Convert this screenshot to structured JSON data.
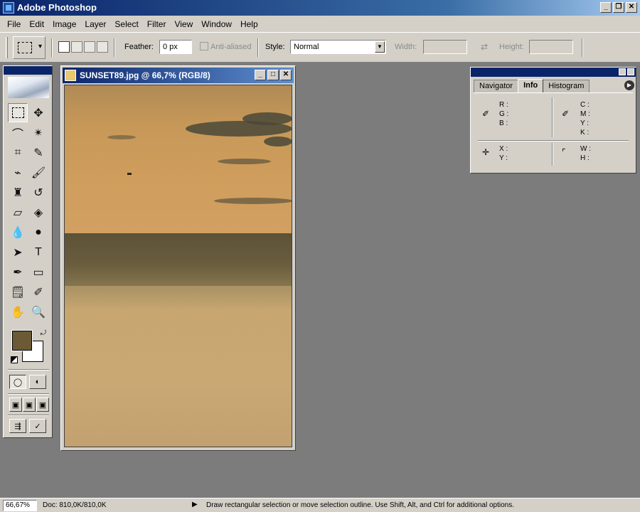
{
  "window": {
    "title": "Adobe Photoshop"
  },
  "menu": [
    "File",
    "Edit",
    "Image",
    "Layer",
    "Select",
    "Filter",
    "View",
    "Window",
    "Help"
  ],
  "options": {
    "feather_label": "Feather:",
    "feather_value": "0 px",
    "antialiased_label": "Anti-aliased",
    "style_label": "Style:",
    "style_value": "Normal",
    "width_label": "Width:",
    "height_label": "Height:"
  },
  "document": {
    "title": "SUNSET89.jpg @ 66,7% (RGB/8)"
  },
  "colors": {
    "foreground": "#6b5a35",
    "background": "#ffffff"
  },
  "info_panel": {
    "tabs": [
      "Navigator",
      "Info",
      "Histogram"
    ],
    "active_tab": "Info",
    "rgb_labels": "R :\nG :\nB :",
    "cmyk_labels": "C :\nM :\nY :\nK :",
    "xy_labels": "X :\nY :",
    "wh_labels": "W :\nH :"
  },
  "status": {
    "zoom": "66,67%",
    "doc": "Doc: 810,0K/810,0K",
    "hint": "Draw rectangular selection or move selection outline.  Use Shift, Alt, and Ctrl for additional options."
  }
}
